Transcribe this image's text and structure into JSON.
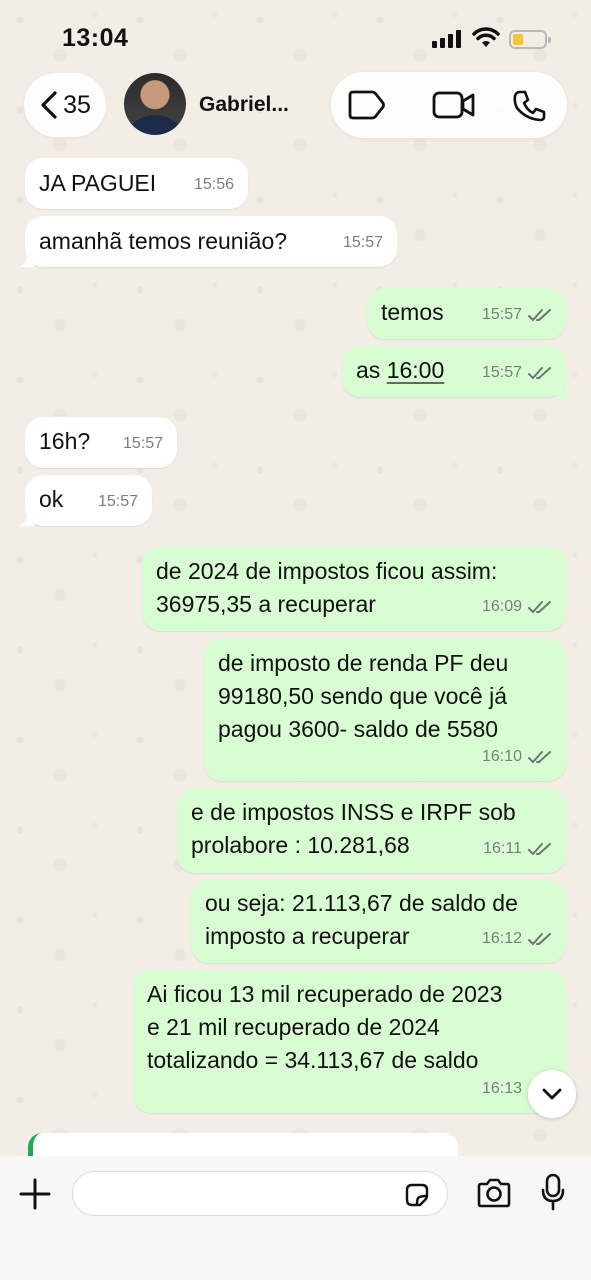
{
  "status_bar": {
    "time": "13:04"
  },
  "header": {
    "back_count": "35",
    "contact_name": "Gabriel...",
    "icons": [
      "chevron-left-icon",
      "label-tag-icon",
      "video-call-icon",
      "phone-icon"
    ]
  },
  "messages": [
    {
      "dir": "in",
      "text": "JA PAGUEI",
      "time": "15:56"
    },
    {
      "dir": "in",
      "text": "amanhã temos reunião?",
      "time": "15:57"
    },
    {
      "dir": "out",
      "text": "temos",
      "time": "15:57"
    },
    {
      "dir": "out",
      "text_prefix": "as ",
      "text_link": "16:00",
      "time": "15:57"
    },
    {
      "dir": "in",
      "text": "16h?",
      "time": "15:57"
    },
    {
      "dir": "in",
      "text": "ok",
      "time": "15:57"
    },
    {
      "dir": "out",
      "text": "de 2024 de impostos ficou assim:\n36975,35 a recuperar",
      "time": "16:09"
    },
    {
      "dir": "out",
      "text": "de imposto de renda PF deu\n99180,50 sendo que você já\npagou 3600- saldo de 5580",
      "time": "16:10"
    },
    {
      "dir": "out",
      "text": "e de impostos INSS e IRPF sob\nprolabore : 10.281,68",
      "time": "16:11"
    },
    {
      "dir": "out",
      "text": "ou seja: 21.113,67 de saldo de\nimposto a recuperar",
      "time": "16:12"
    },
    {
      "dir": "out",
      "text": "Ai ficou 13 mil recuperado de 2023\ne 21 mil recuperado de 2024\ntotalizando = 34.113,67 de saldo",
      "time": "16:13"
    }
  ],
  "composer": {
    "value": "",
    "icons": [
      "plus-icon",
      "sticker-icon",
      "camera-icon",
      "microphone-icon"
    ]
  },
  "colors": {
    "outgoing_bubble": "#d9fdd3",
    "incoming_bubble": "#ffffff",
    "read_tick": "#6b7671",
    "quote_accent": "#1fa855"
  }
}
